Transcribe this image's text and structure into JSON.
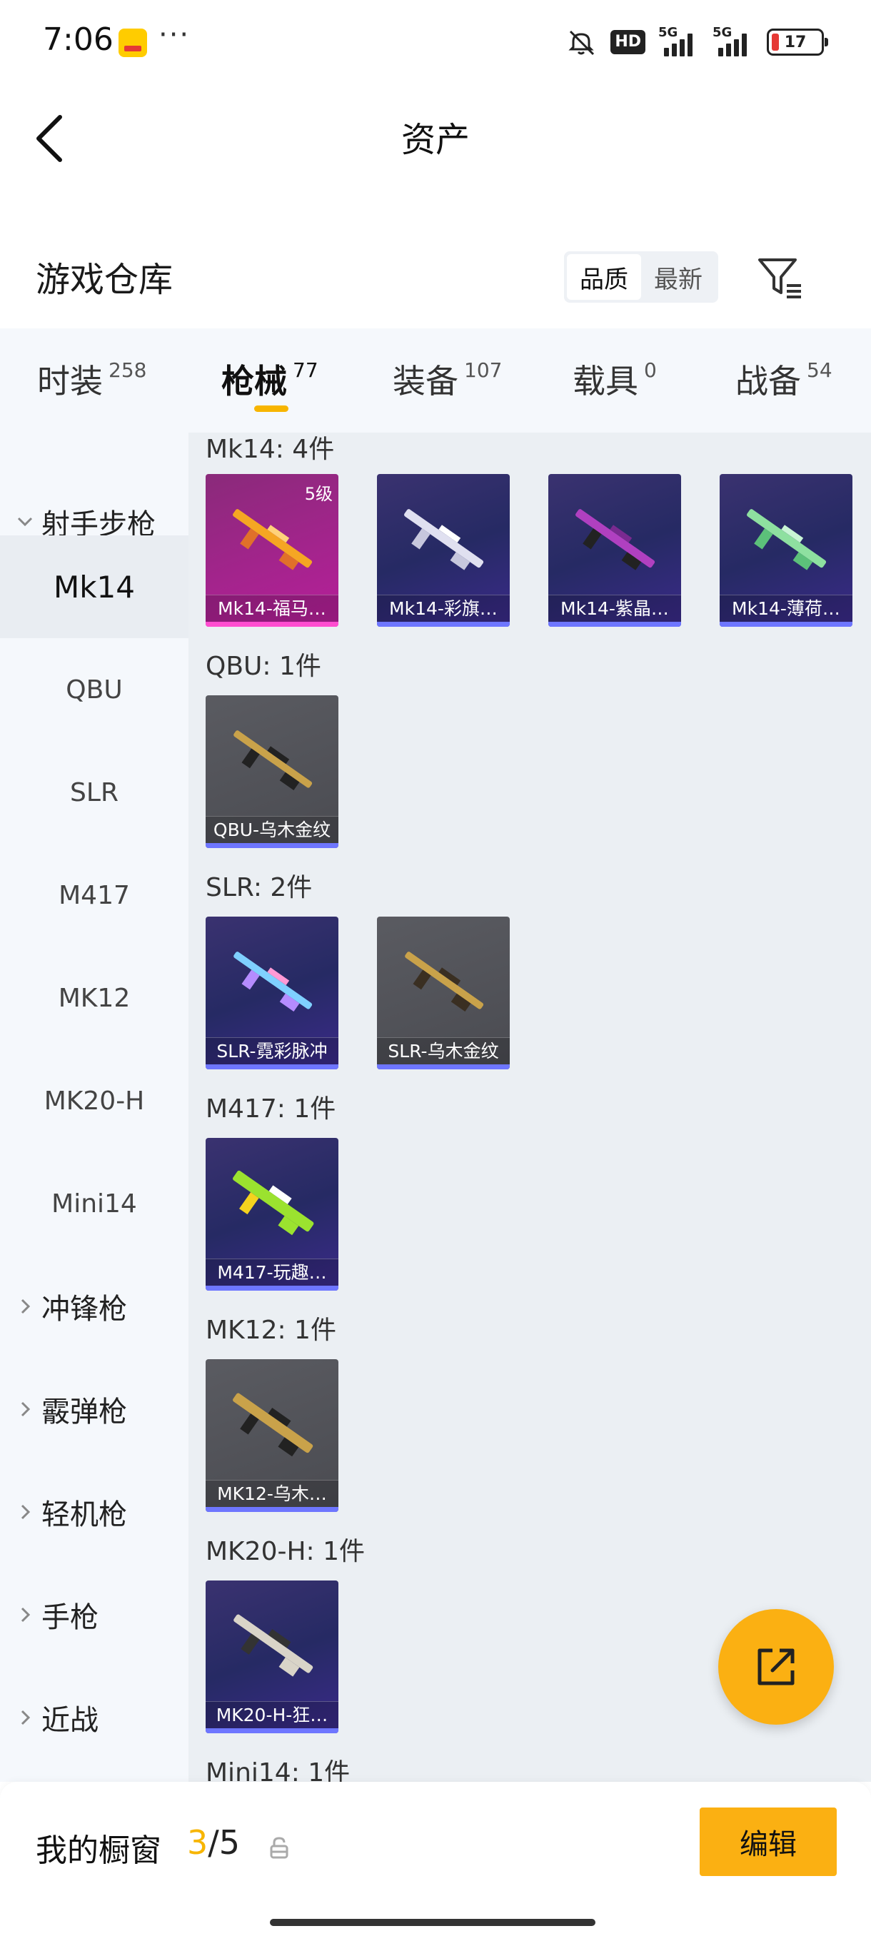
{
  "status_bar": {
    "time": "7:06",
    "more": "···",
    "hd": "HD",
    "network_1": "5G",
    "network_2": "5G",
    "battery": "17"
  },
  "header": {
    "title": "资产"
  },
  "warehouse": {
    "title": "游戏仓库",
    "sort_options": [
      "品质",
      "最新"
    ],
    "sort_selected": "品质"
  },
  "tabs": [
    {
      "label": "时装",
      "count": "258"
    },
    {
      "label": "枪械",
      "count": "77",
      "active": true
    },
    {
      "label": "装备",
      "count": "107"
    },
    {
      "label": "载具",
      "count": "0"
    },
    {
      "label": "战备",
      "count": "54"
    }
  ],
  "sidebar": {
    "groups": [
      {
        "label": "射手步枪",
        "expanded": true
      },
      {
        "label": "冲锋枪"
      },
      {
        "label": "霰弹枪"
      },
      {
        "label": "轻机枪"
      },
      {
        "label": "手枪"
      },
      {
        "label": "近战"
      }
    ],
    "subitems": [
      "Mk14",
      "QBU",
      "SLR",
      "M417",
      "MK12",
      "MK20-H",
      "Mini14"
    ],
    "selected": "Mk14"
  },
  "sections": [
    {
      "title": "Mk14: 4件",
      "items": [
        {
          "name": "Mk14-福马…",
          "level": "5级",
          "color": "#ff4dd0",
          "gun_color": "#f5a623"
        },
        {
          "name": "Mk14-彩旗…",
          "color": "#6e76ff",
          "gun_color": "#e0e0f0"
        },
        {
          "name": "Mk14-紫晶…",
          "color": "#6e76ff",
          "gun_color": "#b040c0"
        },
        {
          "name": "Mk14-薄荷…",
          "color": "#6e76ff",
          "gun_color": "#8ee0a0"
        }
      ]
    },
    {
      "title": "QBU: 1件",
      "items": [
        {
          "name": "QBU-乌木金纹",
          "color": "#6e76ff",
          "gun_color": "#c9a24a"
        }
      ]
    },
    {
      "title": "SLR: 2件",
      "items": [
        {
          "name": "SLR-霓彩脉冲",
          "color": "#6e76ff",
          "gun_color": "#7fd0ff"
        },
        {
          "name": "SLR-乌木金纹",
          "color": "#6e76ff",
          "gun_color": "#c9a24a"
        }
      ]
    },
    {
      "title": "M417: 1件",
      "items": [
        {
          "name": "M417-玩趣…",
          "color": "#6e76ff",
          "gun_color": "#9be22f"
        }
      ]
    },
    {
      "title": "MK12: 1件",
      "items": [
        {
          "name": "MK12-乌木…",
          "color": "#6e76ff",
          "gun_color": "#c9a24a"
        }
      ]
    },
    {
      "title": "MK20-H: 1件",
      "items": [
        {
          "name": "MK20-H-狂…",
          "color": "#6e76ff",
          "gun_color": "#d9d4c8"
        }
      ]
    },
    {
      "title": "Mini14: 1件",
      "items": []
    }
  ],
  "bottom_bar": {
    "showcase_label": "我的橱窗",
    "current": "3",
    "separator": "/",
    "total": "5",
    "edit_label": "编辑"
  },
  "colors": {
    "accent": "#fbb012",
    "rarity_purple": "#6e76ff",
    "rarity_pink": "#ff4dd0"
  }
}
